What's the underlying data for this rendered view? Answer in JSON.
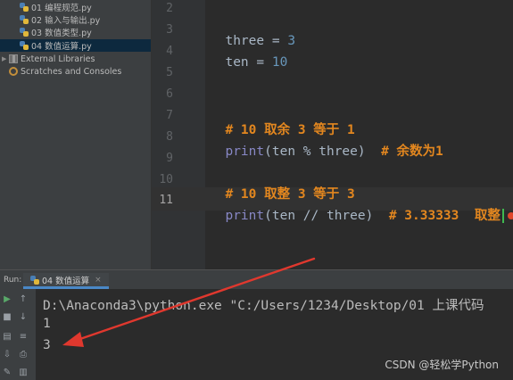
{
  "project_tree": {
    "items": [
      {
        "label": "01 编程规范.py",
        "icon": "python-file-icon"
      },
      {
        "label": "02 输入与输出.py",
        "icon": "python-file-icon"
      },
      {
        "label": "03 数值类型.py",
        "icon": "python-file-icon"
      },
      {
        "label": "04 数值运算.py",
        "icon": "python-file-icon",
        "selected": true
      },
      {
        "label": "External Libraries",
        "icon": "library-icon"
      },
      {
        "label": "Scratches and Consoles",
        "icon": "scratches-icon"
      }
    ]
  },
  "editor": {
    "line_numbers": [
      "2",
      "3",
      "4",
      "5",
      "6",
      "7",
      "8",
      "9",
      "10",
      "11"
    ],
    "current_line": "11",
    "code": {
      "l3_name": "three",
      "l3_eq": " = ",
      "l3_val": "3",
      "l4_name": "ten",
      "l4_eq": " = ",
      "l4_val": "10",
      "l7_comment": "# 10 取余 3 等于 1",
      "l8_func": "print",
      "l8_args": "(ten % three)  ",
      "l8_comment": "# 余数为1",
      "l10_comment": "# 10 取整 3 等于 3",
      "l11_func": "print",
      "l11_args": "(ten // three)  ",
      "l11_comment": "# 3.33333  取整"
    }
  },
  "run_panel": {
    "label": "Run:",
    "tab_label": "04 数值运算",
    "console_lines": [
      "D:\\Anaconda3\\python.exe \"C:/Users/1234/Desktop/01 上课代码",
      "1",
      "3"
    ]
  },
  "annotation": {
    "color": "#e0382e"
  },
  "watermark": "CSDN @轻松学Python"
}
